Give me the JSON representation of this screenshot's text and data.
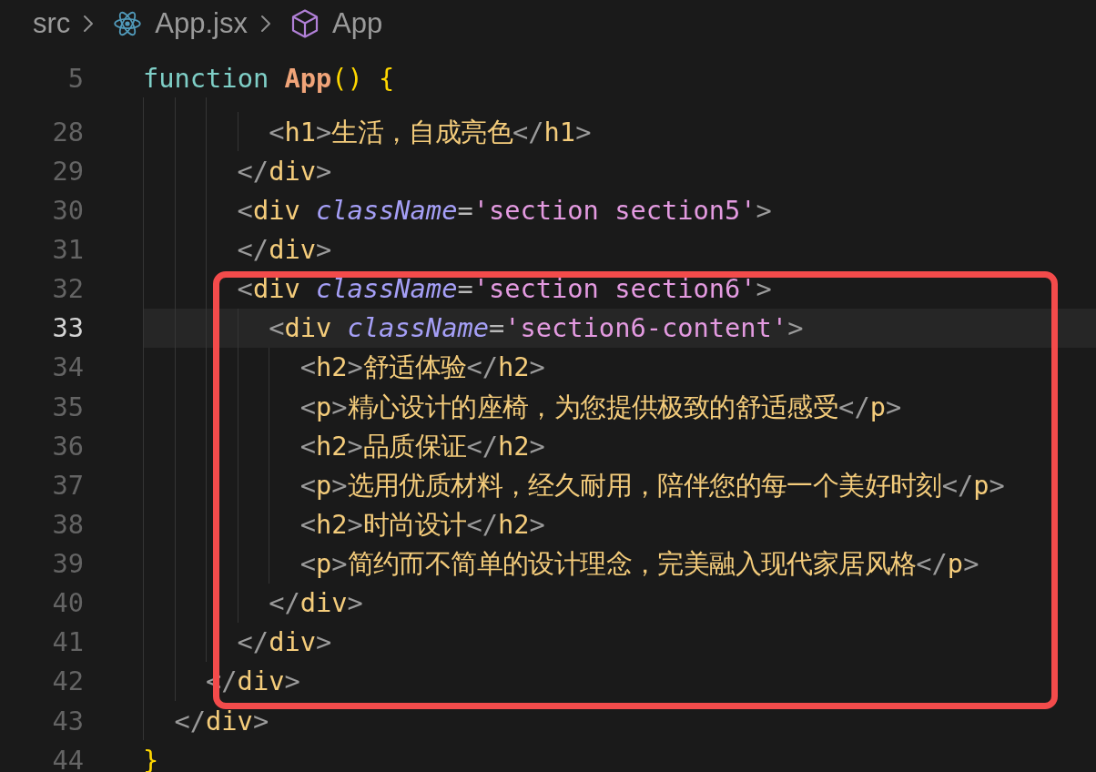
{
  "breadcrumbs": [
    {
      "kind": "folder",
      "label": "src"
    },
    {
      "kind": "file",
      "label": "App.jsx"
    },
    {
      "kind": "symbol",
      "label": "App"
    }
  ],
  "editor": {
    "sticky_lines": [
      {
        "number": "5",
        "current": false,
        "tokens": [
          {
            "kind": "keyword",
            "text": "function "
          },
          {
            "kind": "function",
            "text": "App"
          },
          {
            "kind": "bracket",
            "text": "() {"
          }
        ]
      }
    ],
    "lines": [
      {
        "number": "28",
        "current": false,
        "tokens": [
          {
            "kind": "punct",
            "text": "        <"
          },
          {
            "kind": "tag",
            "text": "h1"
          },
          {
            "kind": "punct",
            "text": ">"
          },
          {
            "kind": "text",
            "text": "生活，自成亮色"
          },
          {
            "kind": "punct",
            "text": "</"
          },
          {
            "kind": "tag",
            "text": "h1"
          },
          {
            "kind": "punct",
            "text": ">"
          }
        ]
      },
      {
        "number": "29",
        "current": false,
        "tokens": [
          {
            "kind": "punct",
            "text": "      </"
          },
          {
            "kind": "tag",
            "text": "div"
          },
          {
            "kind": "punct",
            "text": ">"
          }
        ]
      },
      {
        "number": "30",
        "current": false,
        "tokens": [
          {
            "kind": "punct",
            "text": "      <"
          },
          {
            "kind": "tag",
            "text": "div"
          },
          {
            "kind": "attribute",
            "text": " className"
          },
          {
            "kind": "operator",
            "text": "="
          },
          {
            "kind": "string",
            "text": "'section section5'"
          },
          {
            "kind": "punct",
            "text": ">"
          }
        ]
      },
      {
        "number": "31",
        "current": false,
        "tokens": [
          {
            "kind": "punct",
            "text": "      </"
          },
          {
            "kind": "tag",
            "text": "div"
          },
          {
            "kind": "punct",
            "text": ">"
          }
        ]
      },
      {
        "number": "32",
        "current": false,
        "tokens": [
          {
            "kind": "punct",
            "text": "      <"
          },
          {
            "kind": "tag",
            "text": "div"
          },
          {
            "kind": "attribute",
            "text": " className"
          },
          {
            "kind": "operator",
            "text": "="
          },
          {
            "kind": "string",
            "text": "'section section6'"
          },
          {
            "kind": "punct",
            "text": ">"
          }
        ]
      },
      {
        "number": "33",
        "current": true,
        "tokens": [
          {
            "kind": "punct",
            "text": "        <"
          },
          {
            "kind": "tag",
            "text": "div"
          },
          {
            "kind": "attribute",
            "text": " className"
          },
          {
            "kind": "operator",
            "text": "="
          },
          {
            "kind": "string",
            "text": "'section6-content'"
          },
          {
            "kind": "punct",
            "text": ">"
          }
        ]
      },
      {
        "number": "34",
        "current": false,
        "tokens": [
          {
            "kind": "punct",
            "text": "          <"
          },
          {
            "kind": "tag",
            "text": "h2"
          },
          {
            "kind": "punct",
            "text": ">"
          },
          {
            "kind": "text",
            "text": "舒适体验"
          },
          {
            "kind": "punct",
            "text": "</"
          },
          {
            "kind": "tag",
            "text": "h2"
          },
          {
            "kind": "punct",
            "text": ">"
          }
        ]
      },
      {
        "number": "35",
        "current": false,
        "tokens": [
          {
            "kind": "punct",
            "text": "          <"
          },
          {
            "kind": "tag",
            "text": "p"
          },
          {
            "kind": "punct",
            "text": ">"
          },
          {
            "kind": "text",
            "text": "精心设计的座椅，为您提供极致的舒适感受"
          },
          {
            "kind": "punct",
            "text": "</"
          },
          {
            "kind": "tag",
            "text": "p"
          },
          {
            "kind": "punct",
            "text": ">"
          }
        ]
      },
      {
        "number": "36",
        "current": false,
        "tokens": [
          {
            "kind": "punct",
            "text": "          <"
          },
          {
            "kind": "tag",
            "text": "h2"
          },
          {
            "kind": "punct",
            "text": ">"
          },
          {
            "kind": "text",
            "text": "品质保证"
          },
          {
            "kind": "punct",
            "text": "</"
          },
          {
            "kind": "tag",
            "text": "h2"
          },
          {
            "kind": "punct",
            "text": ">"
          }
        ]
      },
      {
        "number": "37",
        "current": false,
        "tokens": [
          {
            "kind": "punct",
            "text": "          <"
          },
          {
            "kind": "tag",
            "text": "p"
          },
          {
            "kind": "punct",
            "text": ">"
          },
          {
            "kind": "text",
            "text": "选用优质材料，经久耐用，陪伴您的每一个美好时刻"
          },
          {
            "kind": "punct",
            "text": "</"
          },
          {
            "kind": "tag",
            "text": "p"
          },
          {
            "kind": "punct",
            "text": ">"
          }
        ]
      },
      {
        "number": "38",
        "current": false,
        "tokens": [
          {
            "kind": "punct",
            "text": "          <"
          },
          {
            "kind": "tag",
            "text": "h2"
          },
          {
            "kind": "punct",
            "text": ">"
          },
          {
            "kind": "text",
            "text": "时尚设计"
          },
          {
            "kind": "punct",
            "text": "</"
          },
          {
            "kind": "tag",
            "text": "h2"
          },
          {
            "kind": "punct",
            "text": ">"
          }
        ]
      },
      {
        "number": "39",
        "current": false,
        "tokens": [
          {
            "kind": "punct",
            "text": "          <"
          },
          {
            "kind": "tag",
            "text": "p"
          },
          {
            "kind": "punct",
            "text": ">"
          },
          {
            "kind": "text",
            "text": "简约而不简单的设计理念，完美融入现代家居风格"
          },
          {
            "kind": "punct",
            "text": "</"
          },
          {
            "kind": "tag",
            "text": "p"
          },
          {
            "kind": "punct",
            "text": ">"
          }
        ]
      },
      {
        "number": "40",
        "current": false,
        "tokens": [
          {
            "kind": "punct",
            "text": "        </"
          },
          {
            "kind": "tag",
            "text": "div"
          },
          {
            "kind": "punct",
            "text": ">"
          }
        ]
      },
      {
        "number": "41",
        "current": false,
        "tokens": [
          {
            "kind": "punct",
            "text": "      </"
          },
          {
            "kind": "tag",
            "text": "div"
          },
          {
            "kind": "punct",
            "text": ">"
          }
        ]
      },
      {
        "number": "42",
        "current": false,
        "tokens": [
          {
            "kind": "punct",
            "text": "    </"
          },
          {
            "kind": "tag",
            "text": "div"
          },
          {
            "kind": "punct",
            "text": ">"
          }
        ]
      },
      {
        "number": "43",
        "current": false,
        "tokens": [
          {
            "kind": "punct",
            "text": "  </"
          },
          {
            "kind": "tag",
            "text": "div"
          },
          {
            "kind": "punct",
            "text": ">"
          }
        ]
      },
      {
        "number": "44",
        "current": false,
        "tokens": [
          {
            "kind": "bracket",
            "text": "}"
          }
        ]
      }
    ],
    "annotations": [
      {
        "kind": "frame"
      }
    ]
  }
}
